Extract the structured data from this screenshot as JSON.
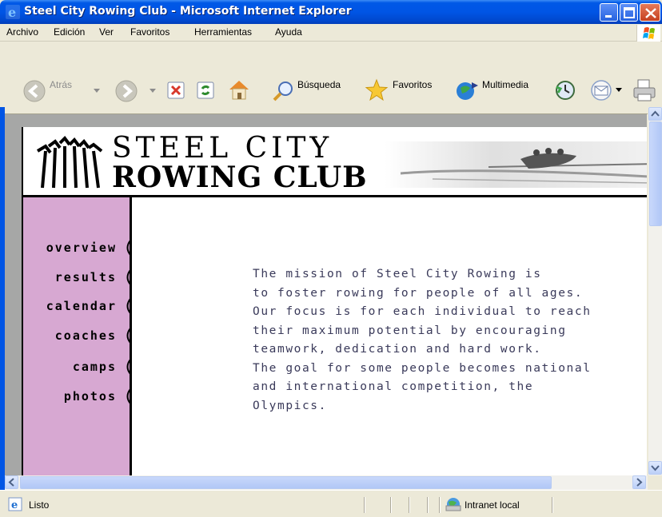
{
  "window": {
    "title": "Steel City Rowing Club - Microsoft Internet Explorer"
  },
  "menu": {
    "items": [
      "Archivo",
      "Edición",
      "Ver",
      "Favoritos",
      "Herramientas",
      "Ayuda"
    ]
  },
  "toolbar": {
    "back_label": "Atrás",
    "search_label": "Búsqueda",
    "favorites_label": "Favoritos",
    "media_label": "Multimedia"
  },
  "site": {
    "logo_line1": "STEEL CITY",
    "logo_line2": "ROWING CLUB",
    "nav": [
      "overview",
      "results",
      "calendar",
      "coaches",
      "camps",
      "photos"
    ],
    "mission_lines": [
      "The mission of Steel City Rowing is",
      "to foster rowing for people of all ages.",
      "Our focus is for each individual to reach",
      "their maximum potential by encouraging",
      "teamwork, dedication and hard work.",
      "The goal for some people becomes national",
      "and international competition, the",
      "Olympics."
    ],
    "colors": {
      "nav_bg": "#D7A8D2",
      "text": "#3a3a5a"
    }
  },
  "status": {
    "text": "Listo",
    "zone": "Intranet local"
  },
  "icons": [
    "ie-icon",
    "minimize-icon",
    "maximize-icon",
    "close-icon",
    "windows-logo-icon",
    "back-icon",
    "forward-icon",
    "stop-icon",
    "refresh-icon",
    "home-icon",
    "search-icon",
    "favorites-star-icon",
    "media-icon",
    "history-icon",
    "mail-icon",
    "print-icon",
    "globe-icon"
  ]
}
